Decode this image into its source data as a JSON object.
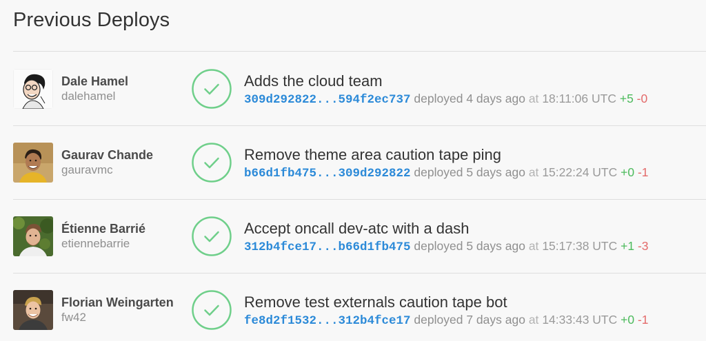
{
  "page": {
    "title": "Previous Deploys"
  },
  "colors": {
    "success": "#6fcf8a",
    "sha_link": "#2c8ad8",
    "additions": "#4cba5c",
    "deletions": "#e36a6a"
  },
  "deploys": [
    {
      "user_name": "Dale Hamel",
      "user_login": "dalehamel",
      "status_icon": "check-circle-icon",
      "commit_title": "Adds the cloud team",
      "sha_range": "309d292822...594f2ec737",
      "deployed_text": "deployed 4 days ago",
      "at_word": "at",
      "time": "18:11:06 UTC",
      "additions": "+5",
      "deletions": "-0"
    },
    {
      "user_name": "Gaurav Chande",
      "user_login": "gauravmc",
      "status_icon": "check-circle-icon",
      "commit_title": "Remove theme area caution tape ping",
      "sha_range": "b66d1fb475...309d292822",
      "deployed_text": "deployed 5 days ago",
      "at_word": "at",
      "time": "15:22:24 UTC",
      "additions": "+0",
      "deletions": "-1"
    },
    {
      "user_name": "Étienne Barrié",
      "user_login": "etiennebarrie",
      "status_icon": "check-circle-icon",
      "commit_title": "Accept oncall dev-atc with a dash",
      "sha_range": "312b4fce17...b66d1fb475",
      "deployed_text": "deployed 5 days ago",
      "at_word": "at",
      "time": "15:17:38 UTC",
      "additions": "+1",
      "deletions": "-3"
    },
    {
      "user_name": "Florian Weingarten",
      "user_login": "fw42",
      "status_icon": "check-circle-icon",
      "commit_title": "Remove test externals caution tape bot",
      "sha_range": "fe8d2f1532...312b4fce17",
      "deployed_text": "deployed 7 days ago",
      "at_word": "at",
      "time": "14:33:43 UTC",
      "additions": "+0",
      "deletions": "-1"
    }
  ]
}
